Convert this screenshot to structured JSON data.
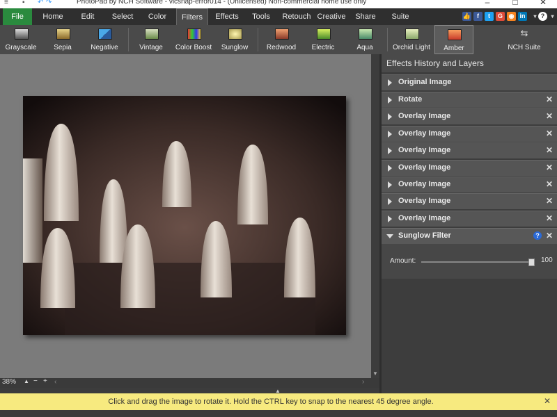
{
  "window": {
    "title": "PhotoPad by NCH Software - vlcsnap-error014 - (Unlicensed) Non-commercial home use only"
  },
  "menu": {
    "tabs": [
      "File",
      "Home",
      "Edit",
      "Select",
      "Color",
      "Filters",
      "Effects",
      "Tools",
      "Retouch",
      "Creative",
      "Share",
      "Suite"
    ],
    "active_tab": "Filters",
    "help_icon": "?"
  },
  "toolbar": {
    "items": [
      {
        "label": "Grayscale",
        "icon": "grayscale-icon"
      },
      {
        "label": "Sepia",
        "icon": "sepia-icon"
      },
      {
        "label": "Negative",
        "icon": "negative-icon"
      },
      {
        "label": "Vintage",
        "icon": "vintage-icon"
      },
      {
        "label": "Color Boost",
        "icon": "color-boost-icon"
      },
      {
        "label": "Sunglow",
        "icon": "sunglow-icon"
      },
      {
        "label": "Redwood",
        "icon": "redwood-icon"
      },
      {
        "label": "Electric",
        "icon": "electric-icon"
      },
      {
        "label": "Aqua",
        "icon": "aqua-icon"
      },
      {
        "label": "Orchid Light",
        "icon": "orchid-light-icon"
      },
      {
        "label": "Amber",
        "icon": "amber-icon"
      },
      {
        "label": "NCH Suite",
        "icon": "nch-suite-icon"
      }
    ],
    "selected": "Amber"
  },
  "panel": {
    "title": "Effects History and Layers",
    "layers": [
      {
        "name": "Original Image",
        "closable": false
      },
      {
        "name": "Rotate",
        "closable": true
      },
      {
        "name": "Overlay Image",
        "closable": true
      },
      {
        "name": "Overlay Image",
        "closable": true
      },
      {
        "name": "Overlay Image",
        "closable": true
      },
      {
        "name": "Overlay Image",
        "closable": true
      },
      {
        "name": "Overlay Image",
        "closable": true
      },
      {
        "name": "Overlay Image",
        "closable": true
      },
      {
        "name": "Overlay Image",
        "closable": true
      }
    ],
    "active_filter": {
      "name": "Sunglow Filter",
      "help": "?",
      "amount_label": "Amount:",
      "amount_value": "100",
      "amount_fraction": 1.0
    }
  },
  "zoom": {
    "level": "38%",
    "minus": "−",
    "plus": "+"
  },
  "hint": {
    "text": "Click and drag the image to rotate it. Hold the CTRL key to snap to the nearest 45 degree angle."
  },
  "colors": {
    "file_tab": "#2a8a3e",
    "hint_background": "#f7ea7f",
    "panel_background": "#3d3d3d",
    "canvas_background": "#7b7b7b"
  }
}
